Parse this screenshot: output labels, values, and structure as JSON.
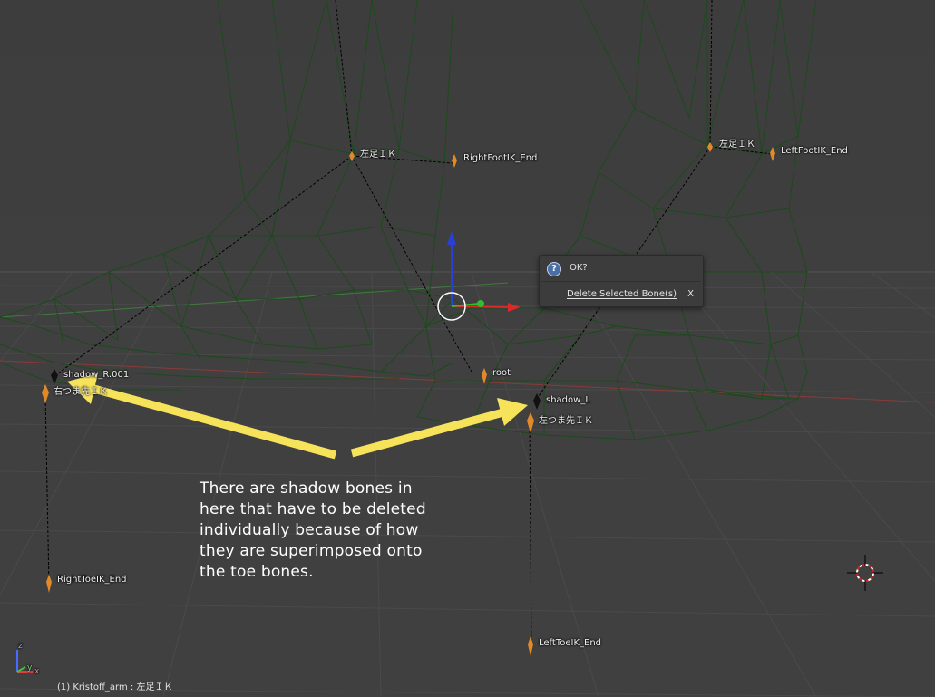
{
  "viewport": {
    "background": "#404040",
    "mesh_color": "#1e4a1e",
    "status_text": "(1) Kristoff_arm : 左足ＩＫ"
  },
  "popup": {
    "title": "OK?",
    "item_label": "Delete Selected Bone(s)",
    "item_shortcut": "X",
    "icon": "question-icon"
  },
  "bones": {
    "left_foot_ik_top": "左足ＩＫ",
    "right_foot_ik_end": "RightFootIK_End",
    "right_foot_ik_top": "左足ＩＫ",
    "left_foot_ik_end": "LeftFootIK_End",
    "shadow_right": "shadow_R.001",
    "right_toe_ik": "右つま先ＩＫ",
    "root": "root",
    "shadow_left": "shadow_L",
    "left_toe_ik": "左つま先ＩＫ",
    "right_toe_ik_end": "RightToeIK_End",
    "left_toe_ik_end": "LeftToeIK_End"
  },
  "annotation": {
    "line1": "There are  shadow bones in",
    "line2": "here that have to be deleted",
    "line3": "individually because of how",
    "line4": "they are superimposed onto",
    "line5": "the toe bones.",
    "arrow_color": "#f7e35a"
  },
  "axes": {
    "x": "x",
    "y": "y",
    "z": "z"
  }
}
